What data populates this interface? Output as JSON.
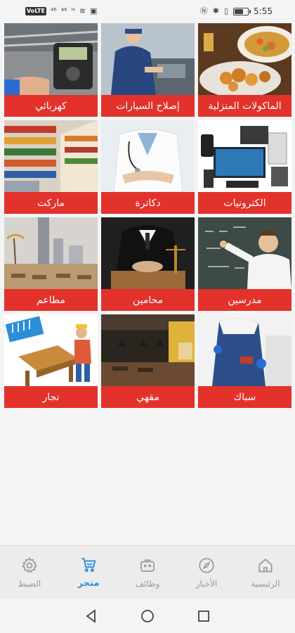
{
  "status_bar": {
    "left_icons": [
      "data-icon",
      "signal-4g-icon",
      "signal-bars-icon",
      "signal-bars-icon",
      "wifi-icon",
      "message-icon"
    ],
    "left_labels": [
      "VoLTE",
      "⁴⁶",
      "⁴⁶",
      "ᴴ",
      "≋",
      "▣"
    ],
    "right_icons": [
      "nfc-icon",
      "bluetooth-icon",
      "vibrate-icon",
      "battery-icon"
    ],
    "right_glyphs": [
      "Ⓝ",
      "✱",
      "▯"
    ],
    "battery_level": 0.62,
    "time": "5:55"
  },
  "tiles": [
    {
      "label": "الماكولات المنزلية",
      "name": "tile-home-food",
      "image": "home-food-photo"
    },
    {
      "label": "إصلاح السيارات",
      "name": "tile-car-repair",
      "image": "mechanic-photo"
    },
    {
      "label": "كهربائي",
      "name": "tile-electrician",
      "image": "electrician-photo"
    },
    {
      "label": "الكترونيات",
      "name": "tile-electronics",
      "image": "electronics-photo"
    },
    {
      "label": "دكاترة",
      "name": "tile-doctors",
      "image": "doctor-photo"
    },
    {
      "label": "ماركت",
      "name": "tile-market",
      "image": "supermarket-photo"
    },
    {
      "label": "مدرسين",
      "name": "tile-teachers",
      "image": "teacher-photo"
    },
    {
      "label": "محامين",
      "name": "tile-lawyers",
      "image": "lawyer-photo"
    },
    {
      "label": "مطاعم",
      "name": "tile-restaurants",
      "image": "city-restaurant-photo"
    },
    {
      "label": "سباك",
      "name": "tile-plumber",
      "image": "plumber-photo"
    },
    {
      "label": "مقهي",
      "name": "tile-cafe",
      "image": "cafe-photo"
    },
    {
      "label": "نجار",
      "name": "tile-carpenter",
      "image": "carpenter-illustration"
    }
  ],
  "bottom_nav": {
    "items": [
      {
        "label": "الضبط",
        "icon": "gear-icon",
        "active": false
      },
      {
        "label": "متجر",
        "icon": "cart-icon",
        "active": true
      },
      {
        "label": "وظائف",
        "icon": "briefcase-icon",
        "active": false
      },
      {
        "label": "الأخبار",
        "icon": "compass-icon",
        "active": false
      },
      {
        "label": "الرئيسية",
        "icon": "home-icon",
        "active": false
      }
    ],
    "active_color": "#2a8fd6",
    "inactive_color": "#9a9a9a"
  },
  "system_nav": {
    "buttons": [
      "back-icon",
      "home-circle-icon",
      "recents-icon"
    ]
  },
  "colors": {
    "label_bg": "#e2322b",
    "background": "#f4f4f4"
  }
}
